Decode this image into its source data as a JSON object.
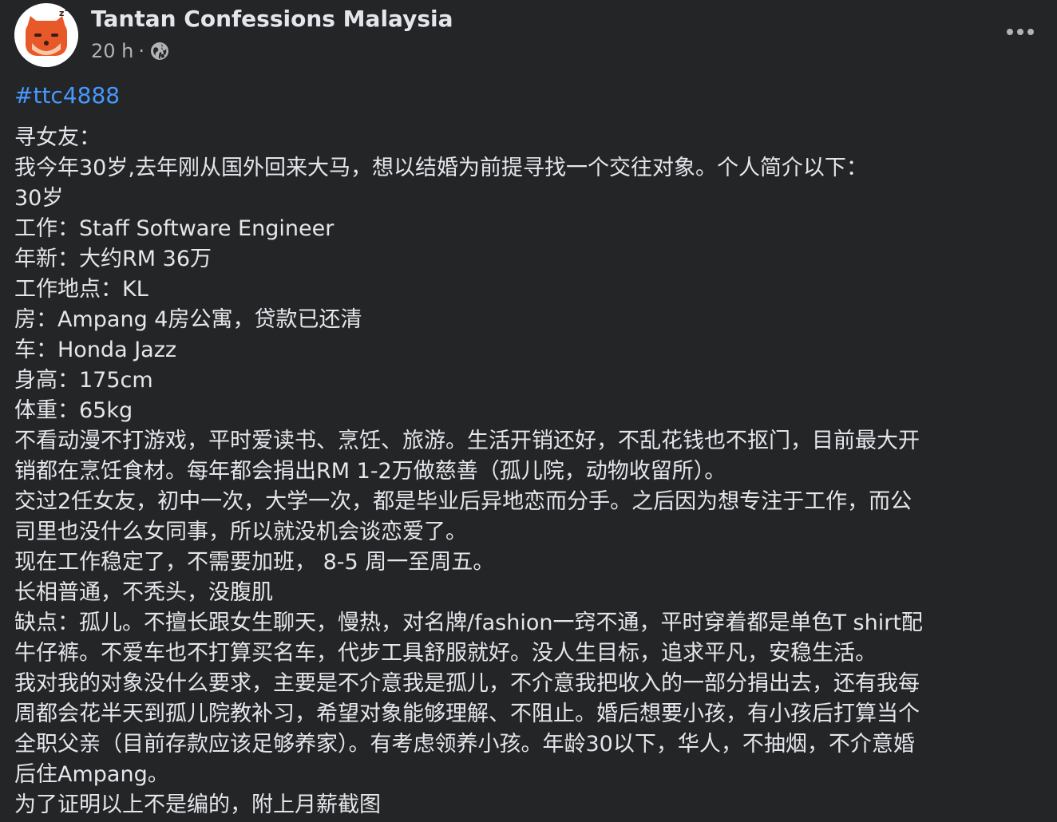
{
  "post": {
    "page_name": "Tantan Confessions Malaysia",
    "time": "20 h",
    "separator": "·",
    "privacy_icon": "globe-icon",
    "more_icon": "more-horizontal-icon",
    "hashtag": "#ttc4888",
    "body_lines": [
      "寻女友：",
      "我今年30岁,去年刚从国外回来大马，想以结婚为前提寻找一个交往对象。个人简介以下：",
      "30岁",
      "工作：Staff Software Engineer",
      "年新：大约RM 36万",
      "工作地点：KL",
      "房：Ampang 4房公寓，贷款已还清",
      "车：Honda Jazz",
      "身高：175cm",
      "体重：65kg",
      "不看动漫不打游戏，平时爱读书、烹饪、旅游。生活开销还好，不乱花钱也不抠门，目前最大开",
      "销都在烹饪食材。每年都会捐出RM 1-2万做慈善（孤儿院，动物收留所）。",
      "交过2任女友，初中一次，大学一次，都是毕业后异地恋而分手。之后因为想专注于工作，而公",
      "司里也没什么女同事，所以就没机会谈恋爱了。",
      "现在工作稳定了，不需要加班， 8-5 周一至周五。",
      "长相普通，不秃头，没腹肌",
      "缺点：孤儿。不擅长跟女生聊天，慢热，对名牌/fashion一窍不通，平时穿着都是单色T shirt配",
      "牛仔裤。不爱车也不打算买名车，代步工具舒服就好。没人生目标，追求平凡，安稳生活。",
      "我对我的对象没什么要求，主要是不介意我是孤儿，不介意我把收入的一部分捐出去，还有我每",
      "周都会花半天到孤儿院教补习，希望对象能够理解、不阻止。婚后想要小孩，有小孩后打算当个",
      "全职父亲（目前存款应该足够养家）。有考虑领养小孩。年龄30以下，华人，不抽烟，不介意婚",
      "后住Ampang。",
      "为了证明以上不是编的，附上月薪截图"
    ]
  },
  "colors": {
    "background": "#242526",
    "primary_text": "#e4e6eb",
    "secondary_text": "#b0b3b8",
    "link": "#4599ff",
    "avatar_orange": "#e8592a"
  }
}
